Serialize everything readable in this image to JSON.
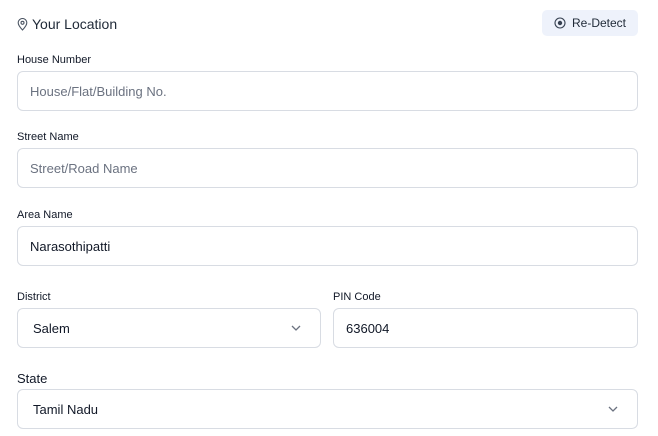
{
  "header": {
    "title": "Your Location",
    "redetect_label": "Re-Detect"
  },
  "form": {
    "house": {
      "label": "House Number",
      "value": "",
      "placeholder": "House/Flat/Building No."
    },
    "street": {
      "label": "Street Name",
      "value": "",
      "placeholder": "Street/Road Name"
    },
    "area": {
      "label": "Area Name",
      "value": "Narasothipatti",
      "placeholder": ""
    },
    "district": {
      "label": "District",
      "value": "Salem"
    },
    "pin": {
      "label": "PIN Code",
      "value": "636004",
      "placeholder": ""
    },
    "state": {
      "label": "State",
      "value": "Tamil Nadu"
    }
  },
  "icons": {
    "header": "location-pin-icon",
    "redetect": "target-icon",
    "dropdown": "chevron-down-icon"
  }
}
